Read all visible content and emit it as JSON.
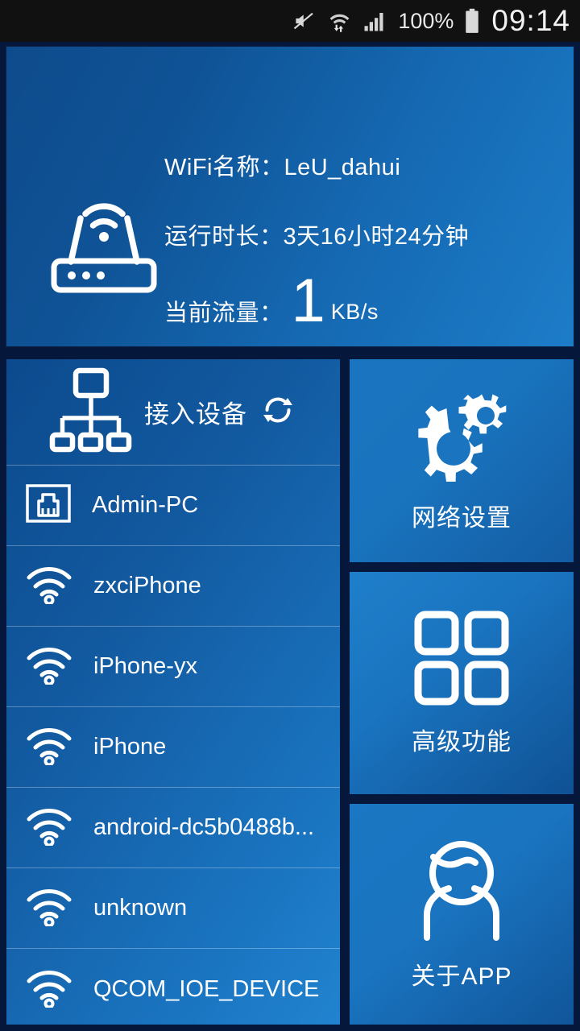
{
  "statusbar": {
    "mute_icon": "mute-icon",
    "wifi_icon": "wifi-transfer-icon",
    "signal_icon": "cellular-signal-icon",
    "battery_percent": "100%",
    "battery_icon": "battery-full-icon",
    "clock": "09:14"
  },
  "header": {
    "router_icon": "router-icon",
    "ssid_label": "WiFi名称：LeU_dahui",
    "uptime_label": "运行时长：3天16小时24分钟",
    "traffic_label": "当前流量：",
    "traffic_value": "1",
    "traffic_unit": "KB/s"
  },
  "devices": {
    "title": "接入设备",
    "topology_icon": "network-topology-icon",
    "refresh_icon": "refresh-icon",
    "items": [
      {
        "name": "Admin-PC",
        "icon": "ethernet-port-icon"
      },
      {
        "name": "zxciPhone",
        "icon": "wifi-icon"
      },
      {
        "name": "iPhone-yx",
        "icon": "wifi-icon"
      },
      {
        "name": "iPhone",
        "icon": "wifi-icon"
      },
      {
        "name": "android-dc5b0488b...",
        "icon": "wifi-icon"
      },
      {
        "name": "unknown",
        "icon": "wifi-icon"
      },
      {
        "name": "QCOM_IOE_DEVICE",
        "icon": "wifi-icon"
      }
    ]
  },
  "tiles": [
    {
      "label": "网络设置",
      "icon": "gears-icon"
    },
    {
      "label": "高级功能",
      "icon": "grid-icon"
    },
    {
      "label": "关于APP",
      "icon": "person-icon"
    }
  ],
  "colors": {
    "accent_blue": "#1a74c0",
    "deep_blue": "#0c4a8d",
    "background": "#05173a",
    "statusbar": "#111112",
    "text": "#ffffff"
  }
}
